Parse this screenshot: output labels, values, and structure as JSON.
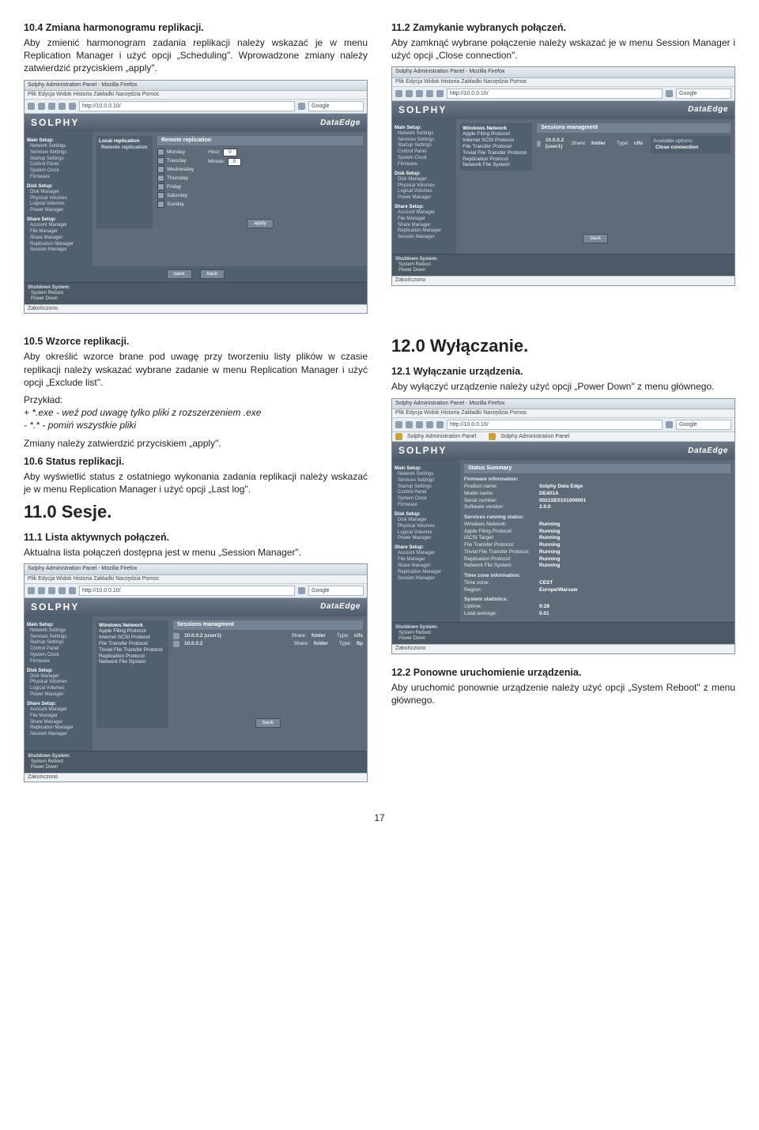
{
  "page_number": "17",
  "left": {
    "s1_heading": "10.4 Zmiana harmonogramu replikacji.",
    "s1_body": "Aby zmienić harmonogram zadania replikacji należy wskazać je w menu Replication Manager i użyć opcji „Scheduling\". Wprowadzone zmiany należy zatwierdzić przyciskiem „apply\".",
    "s2_heading": "10.5 Wzorce replikacji.",
    "s2_body": "Aby określić wzorce brane pod uwagę przy tworzeniu listy plików w czasie replikacji należy wskazać wybrane zadanie w menu Replication Manager i użyć opcji „Exclude list\".",
    "example_label": "Przykład:",
    "example_line1": "+ *.exe - weź pod uwagę tylko pliki z rozszerzeniem .exe",
    "example_line2": "- *.* - pomiń wszystkie pliki",
    "example_apply": "Zmiany należy zatwierdzić przyciskiem „apply\".",
    "s3_heading": "10.6 Status replikacji.",
    "s3_body": "Aby wyświetlić status z ostatniego wykonania zadania replikacji należy wskazać je w menu Replication Manager i użyć opcji „Last log\".",
    "h11": "11.0 Sesje.",
    "s4_heading": "11.1 Lista aktywnych połączeń.",
    "s4_body": "Aktualna lista połączeń dostępna jest w menu „Session Manager\"."
  },
  "right": {
    "s1_heading": "11.2 Zamykanie wybranych połączeń.",
    "s1_body": "Aby zamknąć wybrane połączenie należy wskazać je w menu Session Manager i użyć opcji „Close connection\".",
    "h12": "12.0 Wyłączanie.",
    "s2_heading": "12.1 Wyłączanie urządzenia.",
    "s2_body": "Aby wyłączyć urządzenie należy użyć opcji „Power Down\" z menu głównego.",
    "s3_heading": "12.2 Ponowne uruchomienie urządzenia.",
    "s3_body": "Aby uruchomić ponownie urządzenie należy użyć opcji „System Reboot\" z menu głównego."
  },
  "shot_common": {
    "window_title": "Solphy Administration Panel - Mozilla Firefox",
    "menu": "Plik  Edycja  Widok  Historia  Zakładki  Narzędzia  Pomoc",
    "url": "http://10.0.0.10/",
    "search_placeholder": "Google",
    "brand": "SOLPHY",
    "brand_sub": "DataEdge",
    "status_bar": "Zakończono",
    "footer_lines": [
      "Shutdown System:",
      "System Reboot",
      "Power Down"
    ],
    "sidebar": {
      "main_title": "Main Setup:",
      "main_items": [
        "Network Settings",
        "Services Settings",
        "Startup Settings",
        "Control Panel",
        "System Clock",
        "Firmware"
      ],
      "disk_title": "Disk Setup:",
      "disk_items": [
        "Disk Manager",
        "Physical Volumes",
        "Logical Volumes",
        "Power Manager"
      ],
      "share_title": "Share Setup:",
      "share_items": [
        "Account Manager",
        "File Manager",
        "Share Manager",
        "Replication Manager",
        "Session Manager"
      ]
    }
  },
  "shot1": {
    "sidepanel_title": "Local replication",
    "sidepanel_sub": "Remote replication",
    "panel_title": "Remote replication",
    "days": [
      "Monday",
      "Tuesday",
      "Wednesday",
      "Thursday",
      "Friday",
      "Saturday",
      "Sunday"
    ],
    "time_labels": [
      "Hour:",
      "Minute:"
    ],
    "time_values": [
      "0",
      "0"
    ],
    "btn_apply": "apply",
    "btn_save": "save",
    "btn_back": "back"
  },
  "shot2": {
    "panel_title": "Sessions managment",
    "service_col_title": "Windows Network",
    "service_items": [
      "Apple Filing Protocol",
      "Internet SCSI Protocol",
      "File Transfer Protocol",
      "Trivial File Transfer Protocol",
      "Replication Protocol",
      "Network File System"
    ],
    "row1_ip": "10.0.0.2 (user1)",
    "row1_share_label": "Share:",
    "row1_share_val": "folder",
    "row1_type_label": "Type:",
    "row1_type_val": "cifs",
    "row2_ip": "10.0.0.2",
    "row2_share_label": "Share:",
    "row2_share_val": "folder",
    "row2_type_label": "Type:",
    "row2_type_val": "ftp",
    "btn_back": "back"
  },
  "shot3": {
    "panel_title": "Sessions managment",
    "service_col_title": "Windows Network",
    "service_items": [
      "Apple Filing Protocol",
      "Internet SCSI Protocol",
      "File Transfer Protocol",
      "Trivial File Transfer Protocol",
      "Replication Protocol",
      "Network File System"
    ],
    "row1_ip": "10.0.0.2 (user1)",
    "row1_share_label": "Share:",
    "row1_share_val": "folder",
    "row1_type_label": "Type:",
    "row1_type_val": "cifs",
    "opts_title": "Available options:",
    "opts_item": "Close connection",
    "btn_back": "back"
  },
  "shot4": {
    "tab_label": "Solphy Administration Panel",
    "panel_title": "Status Summary",
    "fw_title": "Firmware information:",
    "rows_fw": [
      [
        "Product name:",
        "Solphy Data Edge"
      ],
      [
        "Model name:",
        "DE401A"
      ],
      [
        "Serial number:",
        "0021SE0101000001"
      ],
      [
        "Software version:",
        "2.0.0"
      ]
    ],
    "srv_title": "Services running status:",
    "rows_srv": [
      [
        "Windows Network:",
        "Running"
      ],
      [
        "Apple Filing Protocol:",
        "Running"
      ],
      [
        "iSCSI Target:",
        "Running"
      ],
      [
        "File Transfer Protocol:",
        "Running"
      ],
      [
        "Trivial File Transfer Protocol:",
        "Running"
      ],
      [
        "Replication Protocol:",
        "Running"
      ],
      [
        "Network File System:",
        "Running"
      ]
    ],
    "tz_title": "Time zone information:",
    "rows_tz": [
      [
        "Time zone:",
        "CEST"
      ],
      [
        "Region:",
        "Europe/Warsaw"
      ]
    ],
    "stat_title": "System statistics:",
    "rows_stat": [
      [
        "Uptime:",
        "0:28"
      ],
      [
        "Load average:",
        "0.01"
      ]
    ]
  }
}
